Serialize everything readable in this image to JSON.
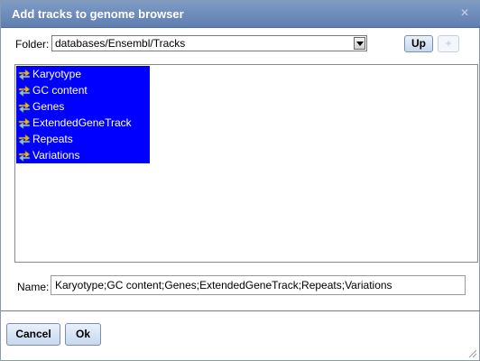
{
  "dialog": {
    "title": "Add tracks to genome browser",
    "close_symbol": "×"
  },
  "folder": {
    "label": "Folder:",
    "value": "databases/Ensembl/Tracks",
    "up_label": "Up",
    "add_label": "+"
  },
  "tracks": [
    {
      "label": "Karyotype",
      "icon": "track-icon",
      "selected": true
    },
    {
      "label": "GC content",
      "icon": "track-icon",
      "selected": true
    },
    {
      "label": "Genes",
      "icon": "track-icon",
      "selected": true
    },
    {
      "label": "ExtendedGeneTrack",
      "icon": "track-icon",
      "selected": true
    },
    {
      "label": "Repeats",
      "icon": "track-icon",
      "selected": true
    },
    {
      "label": "Variations",
      "icon": "track-icon",
      "selected": true
    }
  ],
  "name": {
    "label": "Name:",
    "value": "Karyotype;GC content;Genes;ExtendedGeneTrack;Repeats;Variations"
  },
  "footer": {
    "cancel_label": "Cancel",
    "ok_label": "Ok"
  },
  "colors": {
    "titlebar": "#6f8dbb",
    "selection": "#0000ff",
    "button": "#d6e2f3"
  }
}
